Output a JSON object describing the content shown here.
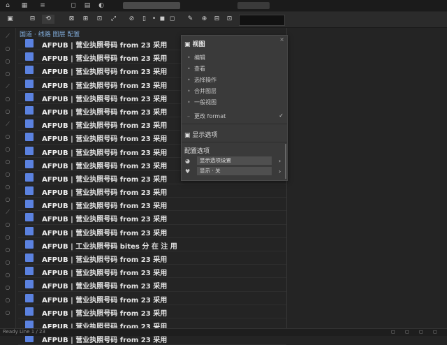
{
  "titlebar": {
    "buttons": [
      "⌂",
      "▦",
      "≡",
      "◻",
      "▤",
      "◐"
    ]
  },
  "toolbar": {
    "items": [
      "▣",
      "⊟",
      "⟲",
      "⊠",
      "⊞",
      "⊡",
      "⤢",
      "⊘",
      "▯",
      "•",
      "◼",
      "◻",
      "✎",
      "⊕",
      "⊟",
      "⊡"
    ]
  },
  "breadcrumb": "国道 · 线路 图层 配置",
  "list": {
    "swatch_color": "#5b82e0",
    "rows": [
      {
        "code": "AFPUB",
        "desc": "| 营业执照号码 from 23 采用"
      },
      {
        "code": "AFPUB",
        "desc": "| 营业执照号码 from 23 采用"
      },
      {
        "code": "AFPUB",
        "desc": "| 营业执照号码 from 23 采用"
      },
      {
        "code": "AFPUB",
        "desc": "| 营业执照号码 from 23 采用"
      },
      {
        "code": "AFPUB",
        "desc": "| 营业执照号码 from 23 采用"
      },
      {
        "code": "AFPUB",
        "desc": "| 营业执照号码 from 23 采用"
      },
      {
        "code": "AFPUB",
        "desc": "| 营业执照号码 from 23 采用"
      },
      {
        "code": "AFPUB",
        "desc": "| 营业执照号码 from 23 采用"
      },
      {
        "code": "AFPUB",
        "desc": "| 营业执照号码 from 23 采用"
      },
      {
        "code": "AFPUB",
        "desc": "| 营业执照号码 from 23 采用"
      },
      {
        "code": "AFPUB",
        "desc": "| 营业执照号码 from 23 采用"
      },
      {
        "code": "AFPUB",
        "desc": "| 营业执照号码 from 23 采用"
      },
      {
        "code": "AFPUB",
        "desc": "| 营业执照号码 from 23 采用"
      },
      {
        "code": "AFPUB",
        "desc": "| 营业执照号码 from 23 采用"
      },
      {
        "code": "AFPUB",
        "desc": "| 营业执照号码 from 23 采用"
      },
      {
        "code": "AFPUB",
        "desc": "| 工业执照号码 bites 分 在 注 用"
      },
      {
        "code": "AFPUB",
        "desc": "| 营业执照号码 from 23 采用"
      },
      {
        "code": "AFPUB",
        "desc": "| 营业执照号码 from 23 采用"
      },
      {
        "code": "AFPUB",
        "desc": "| 营业执照号码 from 23 采用"
      },
      {
        "code": "AFPUB",
        "desc": "| 营业执照号码 from 23 采用"
      },
      {
        "code": "AFPUB",
        "desc": "| 营业执照号码 from 23 采用"
      },
      {
        "code": "AFPUB",
        "desc": "| 营业执照号码 from 23 采用"
      },
      {
        "code": "AFPUB",
        "desc": "| 营业执照号码 from 23 采用"
      }
    ]
  },
  "popup": {
    "title": "视图",
    "items": [
      "编辑",
      "查看",
      "选择操作",
      "合并图层",
      "一般视图"
    ],
    "dropdown": "更改 format",
    "section1": "显示选项",
    "section2": "配置选项",
    "opt1": "显示选项设置",
    "opt2": "显示 · 关",
    "check": "✓"
  },
  "statusbar": {
    "text": "Ready   Line 1 / 23"
  }
}
